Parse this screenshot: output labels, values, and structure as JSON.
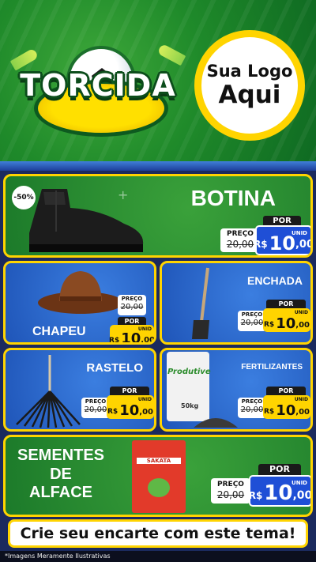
{
  "header": {
    "brand": "TORCIDA",
    "logo_line1": "Sua Logo",
    "logo_line2": "Aqui"
  },
  "currency": "R$",
  "unit": "UNID",
  "products": [
    {
      "name": "BOTINA",
      "discount_badge": "-50%",
      "preco_label": "PREÇO",
      "old_price": "20,00",
      "por_label": "POR",
      "price_int": "10",
      "price_dec": ",00"
    },
    {
      "name": "CHAPEU",
      "preco_label": "PREÇO",
      "old_price": "20,00",
      "por_label": "POR",
      "price_int": "10",
      "price_dec": ",00"
    },
    {
      "name": "ENCHADA",
      "preco_label": "PREÇO",
      "old_price": "20,00",
      "por_label": "POR",
      "price_int": "10",
      "price_dec": ",00"
    },
    {
      "name": "RASTELO",
      "preco_label": "PREÇO",
      "old_price": "20,00",
      "por_label": "POR",
      "price_int": "10",
      "price_dec": ",00"
    },
    {
      "name": "FERTILIZANTES",
      "preco_label": "PREÇO",
      "old_price": "20,00",
      "por_label": "POR",
      "price_int": "10",
      "price_dec": ",00",
      "package_brand": "Produtive",
      "package_weight": "50kg"
    },
    {
      "name_lines": [
        "SEMENTES",
        "DE",
        "ALFACE"
      ],
      "preco_label": "PREÇO",
      "old_price": "20,00",
      "por_label": "POR",
      "price_int": "10",
      "price_dec": ",00",
      "package_brand": "SAKATA"
    }
  ],
  "cta": "Crie seu encarte com este tema!",
  "disclaimer": "*Imagens Meramente Ilustrativas",
  "colors": {
    "green": "#1f8a2a",
    "blue": "#1f55b8",
    "yellow": "#ffd400",
    "navy": "#1b2a5e"
  }
}
